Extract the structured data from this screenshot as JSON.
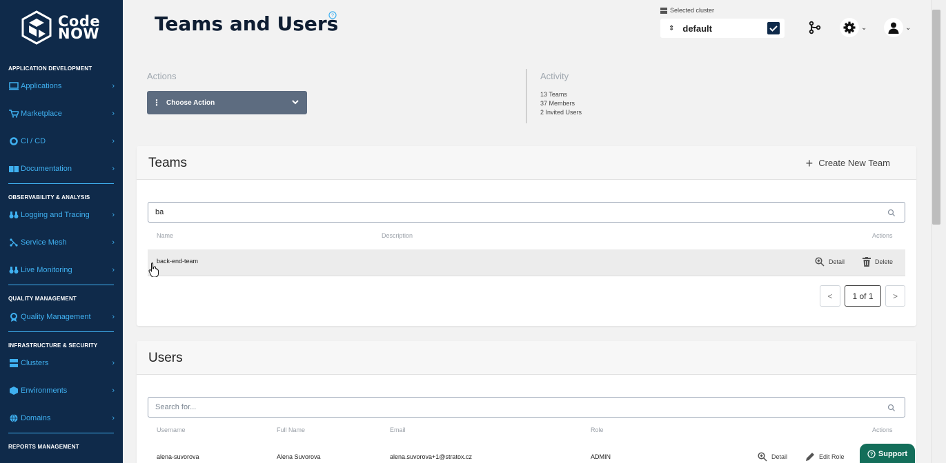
{
  "app": {
    "logo_line1": "Code",
    "logo_line2": "NOW",
    "page_title": "Teams and Users"
  },
  "sidebar": {
    "sections": [
      {
        "title": "APPLICATION DEVELOPMENT",
        "items": [
          {
            "label": "Applications",
            "icon": "monitor-icon"
          },
          {
            "label": "Marketplace",
            "icon": "cart-icon"
          },
          {
            "label": "CI / CD",
            "icon": "circle-icon"
          },
          {
            "label": "Documentation",
            "icon": "book-icon"
          }
        ]
      },
      {
        "title": "OBSERVABILITY & ANALYSIS",
        "items": [
          {
            "label": "Logging and Tracing",
            "icon": "binoculars-icon"
          },
          {
            "label": "Service Mesh",
            "icon": "mesh-icon"
          },
          {
            "label": "Live Monitoring",
            "icon": "binoculars-icon"
          }
        ]
      },
      {
        "title": "QUALITY MANAGEMENT",
        "items": [
          {
            "label": "Quality Management",
            "icon": "award-icon"
          }
        ]
      },
      {
        "title": "INFRASTRUCTURE & SECURITY",
        "items": [
          {
            "label": "Clusters",
            "icon": "server-icon"
          },
          {
            "label": "Environments",
            "icon": "cube-icon"
          },
          {
            "label": "Domains",
            "icon": "globe-icon"
          }
        ]
      },
      {
        "title": "REPORTS MANAGEMENT",
        "items": []
      }
    ]
  },
  "header": {
    "cluster_label": "Selected cluster",
    "cluster_value": "default"
  },
  "actions": {
    "title": "Actions",
    "choose_label": "Choose Action"
  },
  "activity": {
    "title": "Activity",
    "lines": [
      "13 Teams",
      "37 Members",
      "2 Invited Users"
    ]
  },
  "teams": {
    "title": "Teams",
    "create_label": "Create New Team",
    "search_value": "ba",
    "columns": [
      "Name",
      "Description",
      "Actions"
    ],
    "rows": [
      {
        "name": "back-end-team",
        "description": "",
        "detail": "Detail",
        "delete": "Delete"
      }
    ],
    "pagination": {
      "prev": "<",
      "current": "1 of 1",
      "next": ">"
    }
  },
  "users": {
    "title": "Users",
    "search_placeholder": "Search for...",
    "columns": [
      "Username",
      "Full Name",
      "Email",
      "Role",
      "Actions"
    ],
    "rows": [
      {
        "username": "alena-suvorova",
        "full_name": "Alena Suvorova",
        "email": "alena.suvorova+1@stratox.cz",
        "role": "ADMIN",
        "detail": "Detail",
        "edit_role": "Edit Role"
      }
    ]
  },
  "support_label": "Support",
  "colors": {
    "sidebar_bg": "#0f2a4a",
    "accent": "#3fb0f0",
    "support_bg": "#136e5a"
  }
}
